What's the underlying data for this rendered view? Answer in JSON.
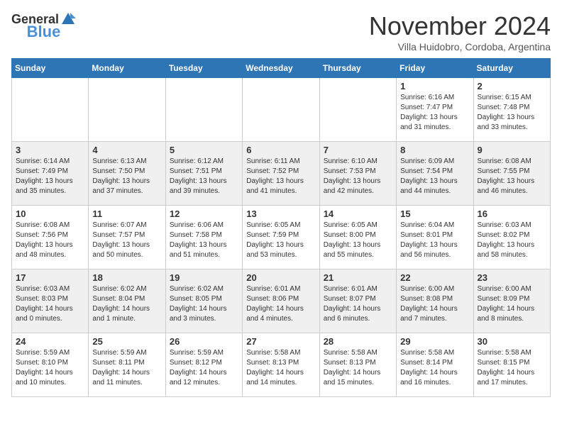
{
  "header": {
    "logo_general": "General",
    "logo_blue": "Blue",
    "month_title": "November 2024",
    "location": "Villa Huidobro, Cordoba, Argentina"
  },
  "days_of_week": [
    "Sunday",
    "Monday",
    "Tuesday",
    "Wednesday",
    "Thursday",
    "Friday",
    "Saturday"
  ],
  "weeks": [
    [
      {
        "day": "",
        "info": ""
      },
      {
        "day": "",
        "info": ""
      },
      {
        "day": "",
        "info": ""
      },
      {
        "day": "",
        "info": ""
      },
      {
        "day": "",
        "info": ""
      },
      {
        "day": "1",
        "info": "Sunrise: 6:16 AM\nSunset: 7:47 PM\nDaylight: 13 hours\nand 31 minutes."
      },
      {
        "day": "2",
        "info": "Sunrise: 6:15 AM\nSunset: 7:48 PM\nDaylight: 13 hours\nand 33 minutes."
      }
    ],
    [
      {
        "day": "3",
        "info": "Sunrise: 6:14 AM\nSunset: 7:49 PM\nDaylight: 13 hours\nand 35 minutes."
      },
      {
        "day": "4",
        "info": "Sunrise: 6:13 AM\nSunset: 7:50 PM\nDaylight: 13 hours\nand 37 minutes."
      },
      {
        "day": "5",
        "info": "Sunrise: 6:12 AM\nSunset: 7:51 PM\nDaylight: 13 hours\nand 39 minutes."
      },
      {
        "day": "6",
        "info": "Sunrise: 6:11 AM\nSunset: 7:52 PM\nDaylight: 13 hours\nand 41 minutes."
      },
      {
        "day": "7",
        "info": "Sunrise: 6:10 AM\nSunset: 7:53 PM\nDaylight: 13 hours\nand 42 minutes."
      },
      {
        "day": "8",
        "info": "Sunrise: 6:09 AM\nSunset: 7:54 PM\nDaylight: 13 hours\nand 44 minutes."
      },
      {
        "day": "9",
        "info": "Sunrise: 6:08 AM\nSunset: 7:55 PM\nDaylight: 13 hours\nand 46 minutes."
      }
    ],
    [
      {
        "day": "10",
        "info": "Sunrise: 6:08 AM\nSunset: 7:56 PM\nDaylight: 13 hours\nand 48 minutes."
      },
      {
        "day": "11",
        "info": "Sunrise: 6:07 AM\nSunset: 7:57 PM\nDaylight: 13 hours\nand 50 minutes."
      },
      {
        "day": "12",
        "info": "Sunrise: 6:06 AM\nSunset: 7:58 PM\nDaylight: 13 hours\nand 51 minutes."
      },
      {
        "day": "13",
        "info": "Sunrise: 6:05 AM\nSunset: 7:59 PM\nDaylight: 13 hours\nand 53 minutes."
      },
      {
        "day": "14",
        "info": "Sunrise: 6:05 AM\nSunset: 8:00 PM\nDaylight: 13 hours\nand 55 minutes."
      },
      {
        "day": "15",
        "info": "Sunrise: 6:04 AM\nSunset: 8:01 PM\nDaylight: 13 hours\nand 56 minutes."
      },
      {
        "day": "16",
        "info": "Sunrise: 6:03 AM\nSunset: 8:02 PM\nDaylight: 13 hours\nand 58 minutes."
      }
    ],
    [
      {
        "day": "17",
        "info": "Sunrise: 6:03 AM\nSunset: 8:03 PM\nDaylight: 14 hours\nand 0 minutes."
      },
      {
        "day": "18",
        "info": "Sunrise: 6:02 AM\nSunset: 8:04 PM\nDaylight: 14 hours\nand 1 minute."
      },
      {
        "day": "19",
        "info": "Sunrise: 6:02 AM\nSunset: 8:05 PM\nDaylight: 14 hours\nand 3 minutes."
      },
      {
        "day": "20",
        "info": "Sunrise: 6:01 AM\nSunset: 8:06 PM\nDaylight: 14 hours\nand 4 minutes."
      },
      {
        "day": "21",
        "info": "Sunrise: 6:01 AM\nSunset: 8:07 PM\nDaylight: 14 hours\nand 6 minutes."
      },
      {
        "day": "22",
        "info": "Sunrise: 6:00 AM\nSunset: 8:08 PM\nDaylight: 14 hours\nand 7 minutes."
      },
      {
        "day": "23",
        "info": "Sunrise: 6:00 AM\nSunset: 8:09 PM\nDaylight: 14 hours\nand 8 minutes."
      }
    ],
    [
      {
        "day": "24",
        "info": "Sunrise: 5:59 AM\nSunset: 8:10 PM\nDaylight: 14 hours\nand 10 minutes."
      },
      {
        "day": "25",
        "info": "Sunrise: 5:59 AM\nSunset: 8:11 PM\nDaylight: 14 hours\nand 11 minutes."
      },
      {
        "day": "26",
        "info": "Sunrise: 5:59 AM\nSunset: 8:12 PM\nDaylight: 14 hours\nand 12 minutes."
      },
      {
        "day": "27",
        "info": "Sunrise: 5:58 AM\nSunset: 8:13 PM\nDaylight: 14 hours\nand 14 minutes."
      },
      {
        "day": "28",
        "info": "Sunrise: 5:58 AM\nSunset: 8:13 PM\nDaylight: 14 hours\nand 15 minutes."
      },
      {
        "day": "29",
        "info": "Sunrise: 5:58 AM\nSunset: 8:14 PM\nDaylight: 14 hours\nand 16 minutes."
      },
      {
        "day": "30",
        "info": "Sunrise: 5:58 AM\nSunset: 8:15 PM\nDaylight: 14 hours\nand 17 minutes."
      }
    ]
  ]
}
